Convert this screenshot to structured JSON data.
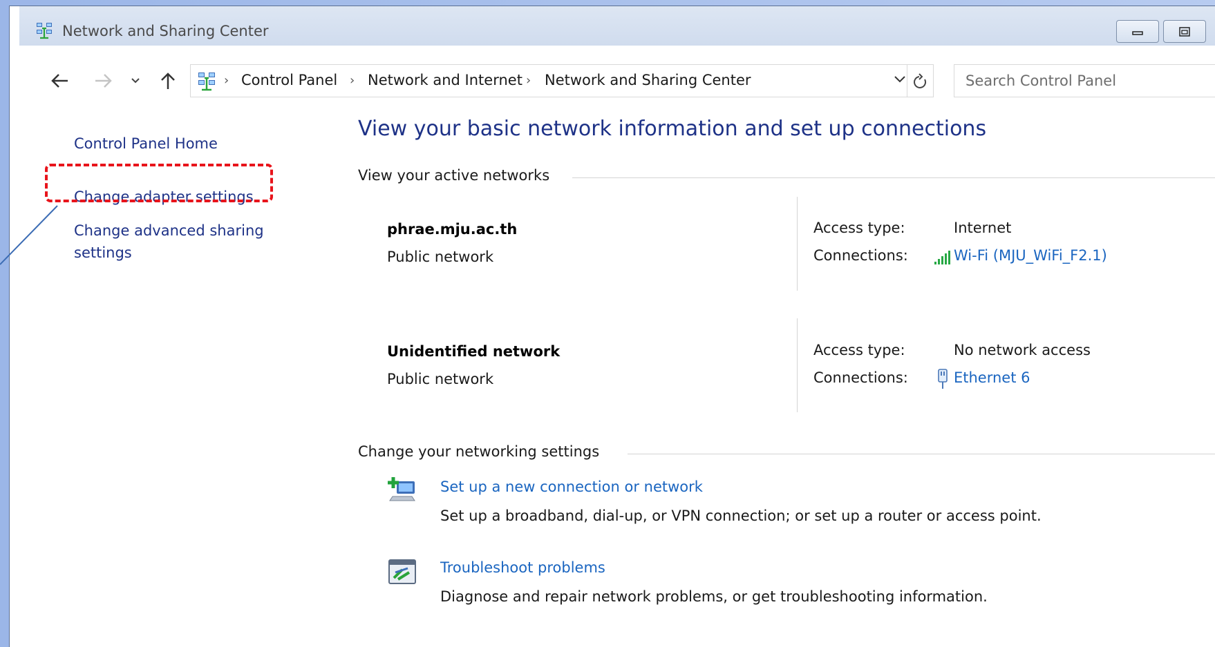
{
  "window": {
    "title": "Network and Sharing Center"
  },
  "navigation": {
    "back_icon": "back-arrow-icon",
    "forward_icon": "forward-arrow-icon",
    "recent_icon": "chevron-down-icon",
    "up_icon": "up-arrow-icon"
  },
  "breadcrumb": {
    "items": [
      "Control Panel",
      "Network and Internet",
      "Network and Sharing Center"
    ]
  },
  "search": {
    "placeholder": "Search Control Panel"
  },
  "sidebar": {
    "items": [
      {
        "label": "Control Panel Home"
      },
      {
        "label": "Change adapter settings"
      },
      {
        "label_line1": "Change advanced sharing",
        "label_line2": "settings"
      }
    ]
  },
  "main": {
    "title": "View your basic network information and set up connections",
    "active_networks_header": "View your active networks",
    "networks": [
      {
        "name": "phrae.mju.ac.th",
        "category": "Public network",
        "access_type_label": "Access type:",
        "access_type": "Internet",
        "connections_label": "Connections:",
        "connection": "Wi-Fi (MJU_WiFi_F2.1)",
        "connection_icon": "wifi-signal-icon"
      },
      {
        "name": "Unidentified network",
        "category": "Public network",
        "access_type_label": "Access type:",
        "access_type": "No network access",
        "connections_label": "Connections:",
        "connection": "Ethernet 6",
        "connection_icon": "ethernet-icon"
      }
    ],
    "settings_header": "Change your networking settings",
    "tasks": [
      {
        "link": "Set up a new connection or network",
        "description": "Set up a broadband, dial-up, or VPN connection; or set up a router or access point.",
        "icon": "new-connection-icon"
      },
      {
        "link": "Troubleshoot problems",
        "description": "Diagnose and repair network problems, or get troubleshooting information.",
        "icon": "troubleshoot-icon"
      }
    ]
  },
  "colors": {
    "link": "#1e3287",
    "hyperlink": "#1a65c0",
    "highlight": "#e8141b"
  }
}
